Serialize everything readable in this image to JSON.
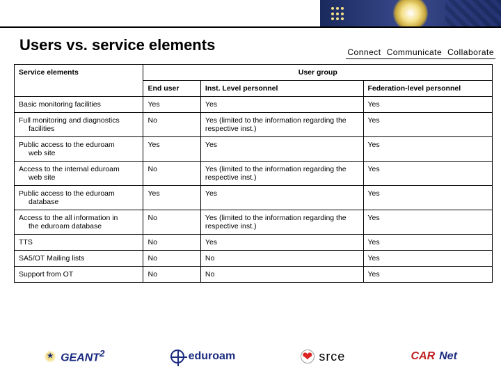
{
  "title": "Users vs. service elements",
  "tagline": {
    "w1": "Connect",
    "w2": "Communicate",
    "w3": "Collaborate"
  },
  "table": {
    "corner": "Service elements",
    "group_header": "User group",
    "cols": {
      "end": "End user",
      "inst": "Inst. Level personnel",
      "fed": "Federation-level personnel"
    },
    "rows": [
      {
        "label_a": "Basic monitoring facilities",
        "label_b": "",
        "end": "Yes",
        "inst": "Yes",
        "fed": "Yes"
      },
      {
        "label_a": "Full monitoring and diagnostics",
        "label_b": "facilities",
        "end": "No",
        "inst": "Yes (limited to the information regarding the respective inst.)",
        "fed": "Yes"
      },
      {
        "label_a": "Public access to the eduroam",
        "label_b": "web site",
        "end": "Yes",
        "inst": "Yes",
        "fed": "Yes"
      },
      {
        "label_a": "Access to the internal eduroam",
        "label_b": "web site",
        "end": "No",
        "inst": "Yes (limited to the information regarding the respective inst.)",
        "fed": "Yes"
      },
      {
        "label_a": "Public access to the eduroam",
        "label_b": "database",
        "end": "Yes",
        "inst": "Yes",
        "fed": "Yes"
      },
      {
        "label_a": "Access to the all information in",
        "label_b": "the eduroam database",
        "end": "No",
        "inst": "Yes (limited to the information regarding the respective inst.)",
        "fed": "Yes"
      },
      {
        "label_a": "TTS",
        "label_b": "",
        "end": "No",
        "inst": "Yes",
        "fed": "Yes"
      },
      {
        "label_a": "SA5/OT Mailing lists",
        "label_b": "",
        "end": "No",
        "inst": "No",
        "fed": "Yes"
      },
      {
        "label_a": "Support from OT",
        "label_b": "",
        "end": "No",
        "inst": "No",
        "fed": "Yes"
      }
    ]
  },
  "logos": {
    "geant": "GEANT",
    "geant_sup": "2",
    "eduroam": "eduroam",
    "srce": "srce",
    "carnet_a": "CAR",
    "carnet_b": "Net"
  }
}
